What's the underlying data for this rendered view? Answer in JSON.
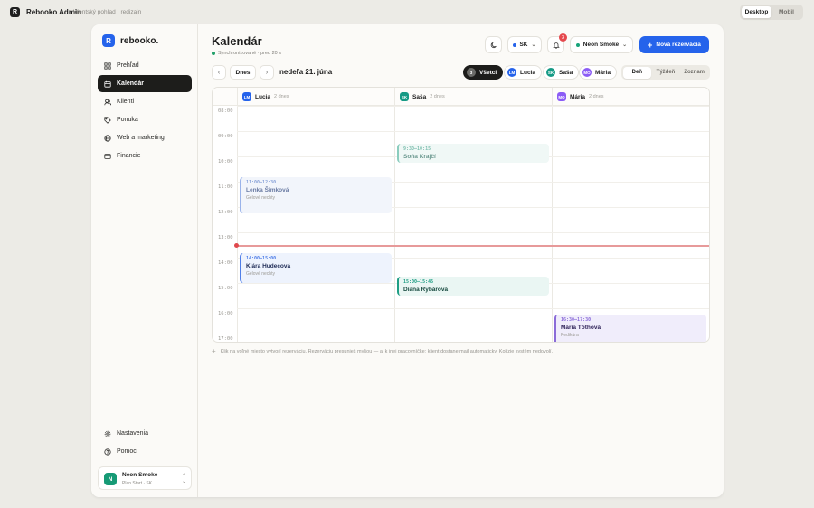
{
  "topbar": {
    "logo_letter": "R",
    "app_name": "Rebooko Admin",
    "subtitle": "klientský pohľad · redizajn",
    "device_options": [
      "Desktop",
      "Mobil"
    ]
  },
  "sidebar": {
    "logo_letter": "R",
    "logo_text": "rebooko.",
    "items": [
      {
        "label": "Prehľad",
        "icon": "grid-icon"
      },
      {
        "label": "Kalendár",
        "icon": "calendar-icon"
      },
      {
        "label": "Klienti",
        "icon": "users-icon"
      },
      {
        "label": "Ponuka",
        "icon": "tag-icon"
      },
      {
        "label": "Web a marketing",
        "icon": "globe-icon"
      },
      {
        "label": "Financie",
        "icon": "card-icon"
      }
    ],
    "bottom_items": [
      {
        "label": "Nastavenia",
        "icon": "gear-icon"
      },
      {
        "label": "Pomoc",
        "icon": "help-icon"
      }
    ],
    "user": {
      "initial": "N",
      "name": "Neon Smoke",
      "plan": "Plan Start · SK"
    }
  },
  "header": {
    "title": "Kalendár",
    "sync_status": "Synchronizované · pred 20 s",
    "language": "SK",
    "notifications_count": "3",
    "studio": "Neon Smoke",
    "new_booking": "Nová rezervácia"
  },
  "toolbar": {
    "prev": "‹",
    "next": "›",
    "today": "Dnes",
    "date": "nedeľa 21. júna",
    "staff": [
      {
        "initials": "3",
        "label": "Všetci",
        "color": "#6b6b68",
        "active": true
      },
      {
        "initials": "LM",
        "label": "Lucia",
        "color": "#2563eb",
        "active": false
      },
      {
        "initials": "SK",
        "label": "Saša",
        "color": "#169a85",
        "active": false
      },
      {
        "initials": "MO",
        "label": "Mária",
        "color": "#8b5cf6",
        "active": false
      }
    ],
    "views": [
      "Deň",
      "Týždeň",
      "Zoznam"
    ],
    "active_view": "Deň"
  },
  "calendar": {
    "columns": [
      {
        "initials": "LM",
        "name": "Lucia",
        "sub": "2 dnes",
        "color": "#2563eb"
      },
      {
        "initials": "SK",
        "name": "Saša",
        "sub": "2 dnes",
        "color": "#169a85"
      },
      {
        "initials": "MO",
        "name": "Mária",
        "sub": "2 dnes",
        "color": "#8b5cf6"
      }
    ],
    "times": [
      "08:00",
      "09:00",
      "10:00",
      "11:00",
      "12:00",
      "13:00",
      "14:00",
      "15:00",
      "16:00",
      "17:00"
    ],
    "events": [
      {
        "col": 1,
        "start": "09:30",
        "end": "10:15",
        "time": "9:30–10:15",
        "name": "Soňa Krajčí",
        "service": "",
        "style": "tealfade"
      },
      {
        "col": 0,
        "start": "10:50",
        "end": "12:15",
        "time": "11:00–12:30",
        "name": "Lenka Šimková",
        "service": "Gélové nechty",
        "style": "bluefade"
      },
      {
        "col": 0,
        "start": "13:50",
        "end": "15:00",
        "time": "14:00–15:00",
        "name": "Klára Hudecová",
        "service": "Gélové nechty",
        "style": "blue"
      },
      {
        "col": 1,
        "start": "14:45",
        "end": "15:30",
        "time": "15:00–15:45",
        "name": "Diana Rybárová",
        "service": "",
        "style": "teal"
      },
      {
        "col": 2,
        "start": "16:15",
        "end": "17:30",
        "time": "16:30–17:30",
        "name": "Mária Tóthová",
        "service": "Pedikúra",
        "style": "purple"
      }
    ],
    "now": "13:30"
  },
  "hint": "Klik na voľné miesto vytvorí rezerváciu. Rezerváciu presunieš myšou — aj k inej pracovníčke; klient dostane mail automaticky. Kolízie systém nedovolí."
}
